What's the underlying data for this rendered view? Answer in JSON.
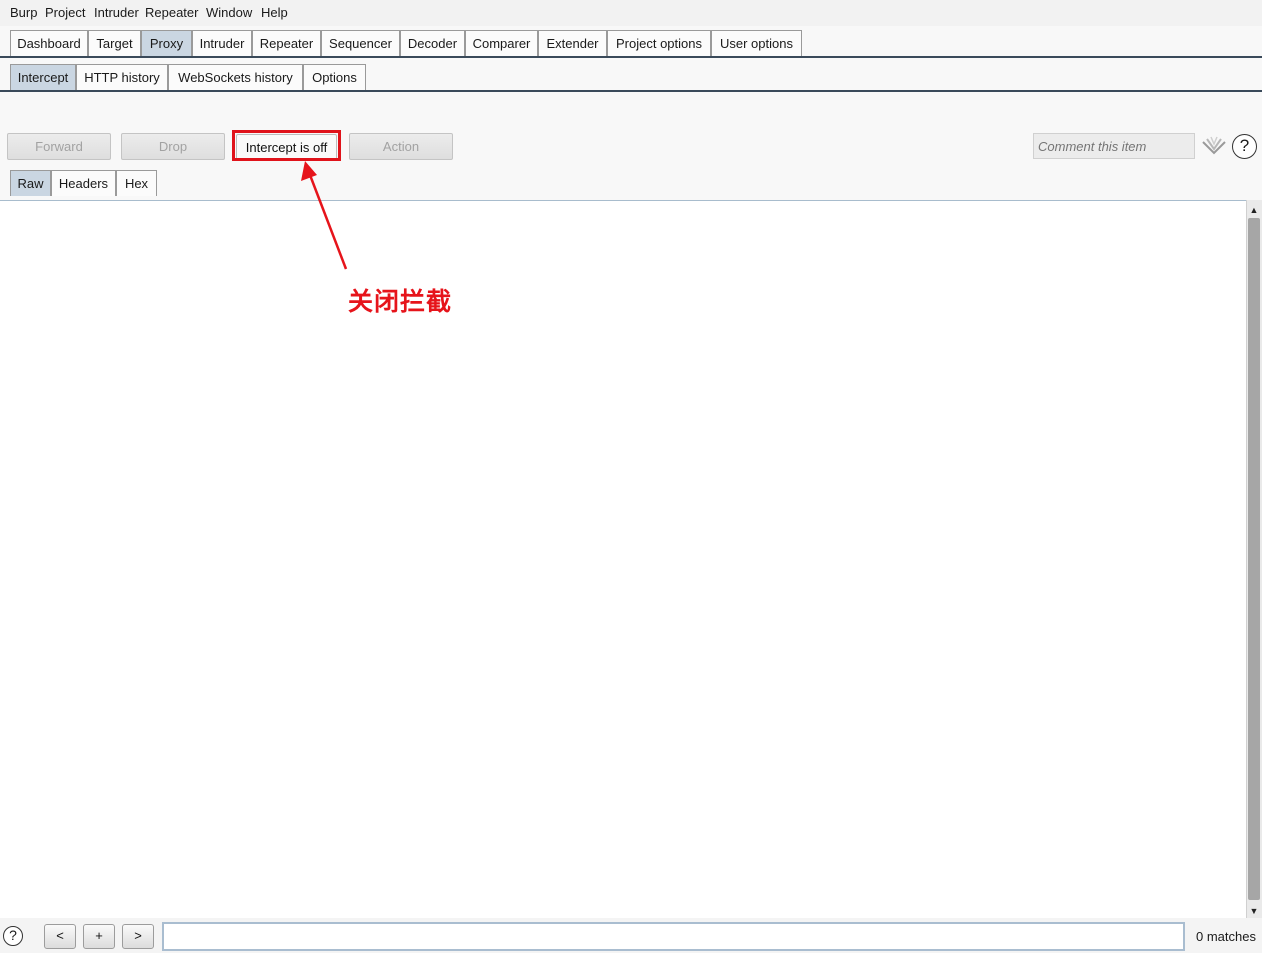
{
  "menu": [
    "Burp",
    "Project",
    "Intruder",
    "Repeater",
    "Window",
    "Help"
  ],
  "main_tabs": [
    "Dashboard",
    "Target",
    "Proxy",
    "Intruder",
    "Repeater",
    "Sequencer",
    "Decoder",
    "Comparer",
    "Extender",
    "Project options",
    "User options"
  ],
  "main_tab_selected": "Proxy",
  "proxy_tabs": [
    "Intercept",
    "HTTP history",
    "WebSockets history",
    "Options"
  ],
  "proxy_tab_selected": "Intercept",
  "toolbar": {
    "forward": "Forward",
    "drop": "Drop",
    "intercept_toggle": "Intercept is off",
    "action": "Action",
    "comment_placeholder": "Comment this item"
  },
  "view_tabs": [
    "Raw",
    "Headers",
    "Hex"
  ],
  "view_tab_selected": "Raw",
  "annotation": {
    "text": "关闭拦截",
    "color": "#e0131b"
  },
  "bottom": {
    "prev": "<",
    "add": "+",
    "next": ">",
    "matches": "0 matches"
  },
  "colors": {
    "selected_tab": "#cad6e2",
    "annotation_red": "#e0131b"
  }
}
